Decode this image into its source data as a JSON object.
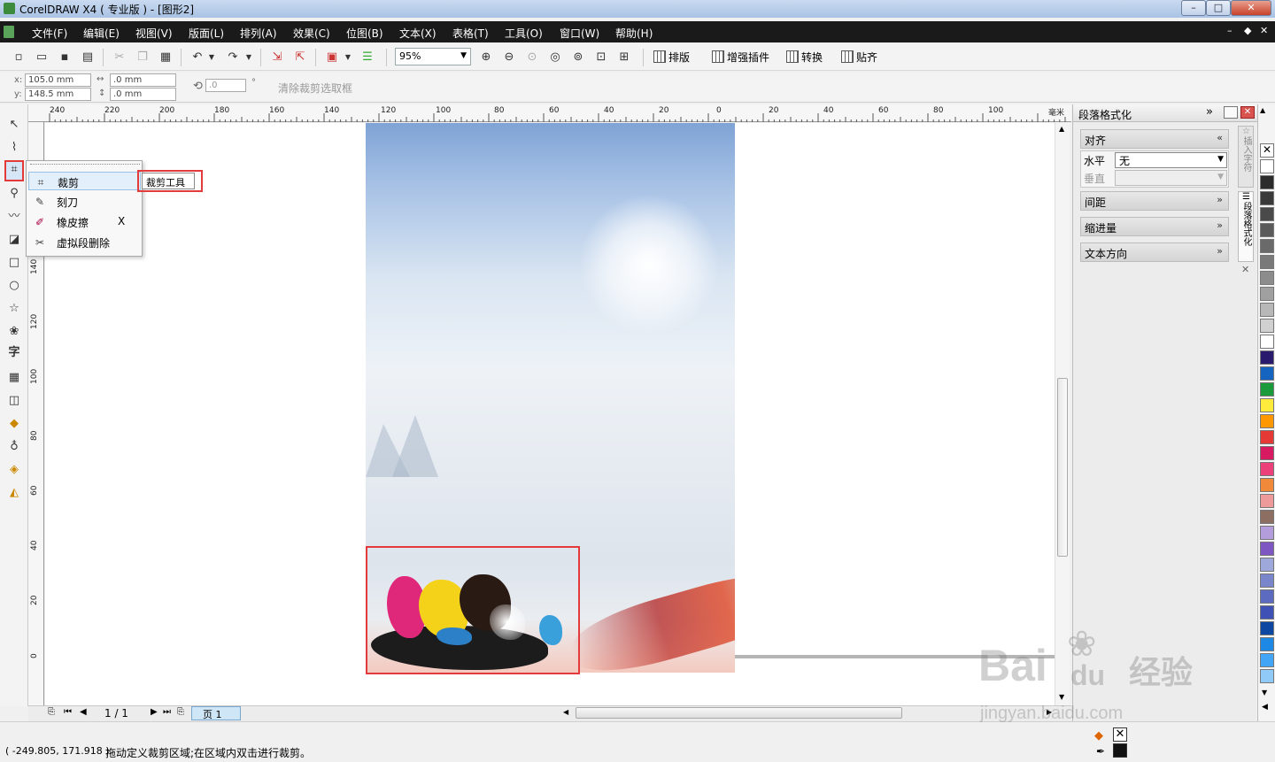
{
  "window": {
    "title": "CorelDRAW X4 ( 专业版 ) - [图形2]",
    "min": "–",
    "max": "□",
    "close": "✕"
  },
  "menu": {
    "items": [
      "文件(F)",
      "编辑(E)",
      "视图(V)",
      "版面(L)",
      "排列(A)",
      "效果(C)",
      "位图(B)",
      "文本(X)",
      "表格(T)",
      "工具(O)",
      "窗口(W)",
      "帮助(H)"
    ],
    "mdi_min": "–",
    "mdi_restore": "◆",
    "mdi_close": "✕"
  },
  "toolbar": {
    "zoom": "95%",
    "plugins": [
      "排版",
      "增强插件",
      "转换",
      "贴齐"
    ]
  },
  "propbar": {
    "x_label": "x:",
    "y_label": "y:",
    "x": "105.0 mm",
    "y": "148.5 mm",
    "w": ".0 mm",
    "h": ".0 mm",
    "angle": ".0",
    "degree": "°",
    "clear_crop": "清除裁剪选取框"
  },
  "ruler": {
    "top_labels": [
      "240",
      "220",
      "200",
      "180",
      "160",
      "140",
      "120",
      "100",
      "80",
      "60",
      "40",
      "20",
      "0",
      "20",
      "40",
      "60",
      "80",
      "100"
    ],
    "top_unit": "毫米",
    "left_labels": [
      "140",
      "120",
      "100",
      "80",
      "60",
      "40",
      "20",
      "0"
    ]
  },
  "flyout": {
    "items": [
      {
        "label": "裁剪",
        "icon": "crop-icon",
        "shortcut": ""
      },
      {
        "label": "刻刀",
        "icon": "knife-icon",
        "shortcut": ""
      },
      {
        "label": "橡皮擦",
        "icon": "eraser-icon",
        "shortcut": "X"
      },
      {
        "label": "虚拟段删除",
        "icon": "virtual-segment-delete-icon",
        "shortcut": ""
      }
    ],
    "tooltip": "裁剪工具"
  },
  "docker": {
    "title": "段落格式化",
    "sections": [
      {
        "label": "对齐",
        "chev": "«"
      },
      {
        "label": "间距",
        "chev": "»"
      },
      {
        "label": "缩进量",
        "chev": "»"
      },
      {
        "label": "文本方向",
        "chev": "»"
      }
    ],
    "horizontal_label": "水平",
    "horizontal_value": "无",
    "vertical_label": "垂直",
    "side_tabs": [
      "插入字符",
      "段落格式化"
    ]
  },
  "pagenav": {
    "count": "1 / 1",
    "tab": "页 1"
  },
  "status": {
    "coords": "( -249.805, 171.918 )",
    "hint": "拖动定义裁剪区域;在区域内双击进行裁剪。"
  },
  "watermark": {
    "brand": "Bai",
    "brand2": "du",
    "cn": "经验",
    "url": "jingyan.baidu.com"
  },
  "palette": {
    "colors": [
      "#ffffff",
      "#2b2b2b",
      "#3a3a3a",
      "#4a4a4a",
      "#5a5a5a",
      "#6a6a6a",
      "#7a7a7a",
      "#8c8c8c",
      "#a0a0a0",
      "#b8b8b8",
      "#d0d0d0",
      "#ffffff",
      "#2a1a6e",
      "#1565c0",
      "#1a9a3a",
      "#ffeb3b",
      "#ff9800",
      "#e53935",
      "#d81b60",
      "#ec407a",
      "#f08a3a",
      "#ef9a9a",
      "#8d6e63",
      "#b39ddb",
      "#7e57c2",
      "#9fa8da",
      "#7986cb",
      "#5c6bc0",
      "#3f51b5",
      "#0d47a1",
      "#1e88e5",
      "#42a5f5",
      "#90caf9"
    ]
  }
}
